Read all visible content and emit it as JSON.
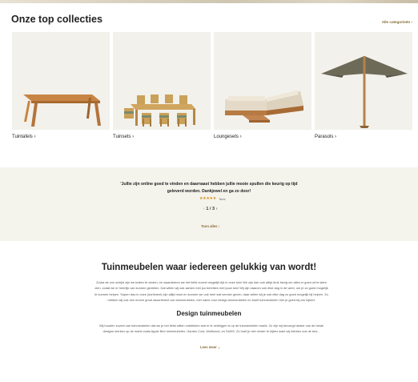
{
  "collections": {
    "title": "Onze top collecties",
    "all_categories": "Alle categorieën",
    "items": [
      {
        "label": "Tuintafels"
      },
      {
        "label": "Tuinsets"
      },
      {
        "label": "Loungesets"
      },
      {
        "label": "Parasols"
      }
    ]
  },
  "testimonial": {
    "quote": "'Jullie zijn online goed te vinden en daarnaast hebben jullie mooie spullen die keurig op tijd geleverd worden. Dankjewel en ga zo door!",
    "stars": "★★★★★",
    "reviewer": "Tees",
    "pager": "1 / 3",
    "prev": "‹",
    "next": "›",
    "all_link": "Toon alles"
  },
  "about": {
    "heading": "Tuinmeubelen waar iedereen gelukkig van wordt!",
    "paragraph": "Zodra de zon schijnt zijn we buiten te vinden, en waardeeren we het liefst zoveel mogelijk tijd in onze tuin! We zijn dan ook altijd druk bezig om alles er goed uit te laten zien, zodat we er heerlijk van kunnen genieten. Dat willen wij ook samen met jou bereiken met jouw tuin! Wij zijn daarom ook elke dag in de weer, om je zo goed mogelijk te kunnen helpen. Superr das in onze (sortiment) zijn altijd mooi en kunnen we ook heel wat service geven, daar willen wij je ook elke dag zo goed mogelijk bij helpen. Zo hebben wij ook een enorm groot assortiment van tuinmeubelen, met name voor design tuinmeubelen en boeit tuinmeubelen hier je goed bij zou kijken!",
    "subheading": "Design tuinmeubelen",
    "paragraph2": "Wij houden zoveel van tuinmeubelen dat we je het liefst willen ontdekken wat er te verkrijgen is op de tuinmeubelen markt. Zo zijn wij bevoegd dealer van de beste designs merken op de markt zoals Apple Bee tuinmeubelen, Garden Cool, Wolfwood, en SUNS. Zo hoef je niet verder te kijken want wij hebben ook de bes...",
    "more_link": "Lees meer"
  }
}
